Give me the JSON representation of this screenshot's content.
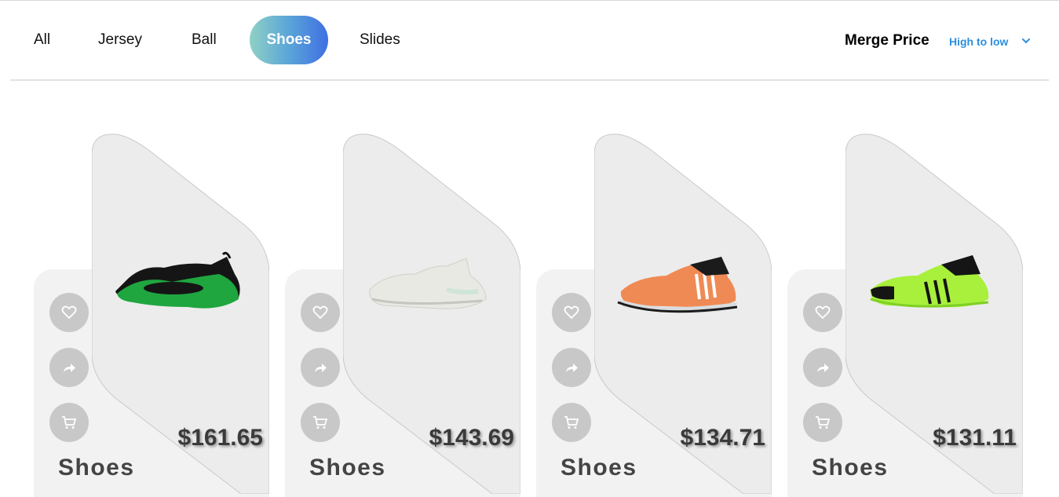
{
  "tabs": [
    {
      "label": "All",
      "active": false
    },
    {
      "label": "Jersey",
      "active": false
    },
    {
      "label": "Ball",
      "active": false
    },
    {
      "label": "Shoes",
      "active": true
    },
    {
      "label": "Slides",
      "active": false
    }
  ],
  "sort": {
    "label": "Merge Price",
    "value": "High to low"
  },
  "accent_color": "#2d8fe0",
  "products": [
    {
      "price": "$161.65",
      "category": "Shoes",
      "image": "green-black-basketball-shoe"
    },
    {
      "price": "$143.69",
      "category": "Shoes",
      "image": "white-basketball-shoe"
    },
    {
      "price": "$134.71",
      "category": "Shoes",
      "image": "orange-basketball-shoe"
    },
    {
      "price": "$131.11",
      "category": "Shoes",
      "image": "lime-green-basketball-shoe"
    }
  ],
  "actions": [
    "heart-icon",
    "share-icon",
    "cart-icon"
  ]
}
